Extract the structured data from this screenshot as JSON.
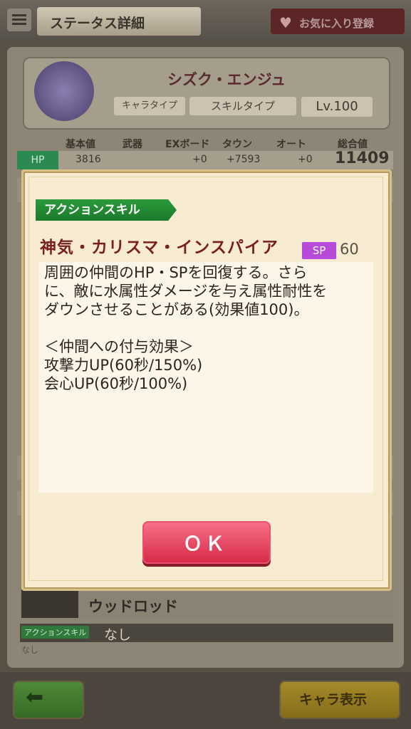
{
  "header": {
    "title": "ステータス詳細",
    "favorite_label": "お気に入り登録"
  },
  "character": {
    "name": "シズク・エンジュ",
    "chara_type_label": "キャラタイプ",
    "skill_type_label": "スキルタイプ",
    "level": "Lv.100"
  },
  "stats": {
    "columns": [
      "基本値",
      "武器",
      "EXボード",
      "タウン",
      "オート",
      "総合値"
    ],
    "hp": {
      "label": "HP",
      "base": "3816",
      "weapon": "",
      "ex_board": "+0",
      "town": "+7593",
      "auto": "+0",
      "total": "11409"
    }
  },
  "equipment": {
    "weapon_name": "ウッドロッド",
    "skill_badge": "アクションスキル",
    "skill_value": "なし",
    "skill_desc": "なし"
  },
  "footer": {
    "chara_button_label": "キャラ表示"
  },
  "modal": {
    "section_label": "アクションスキル",
    "skill_name": "神気・カリスマ・インスパイア",
    "sp_label": "SP",
    "sp_value": "60",
    "description": "周囲の仲間のHP・SPを回復する。さら\nに、敵に水属性ダメージを与え属性耐性を\nダウンさせることがある(効果値100)。\n\n＜仲間への付与効果＞\n攻撃力UP(60秒/150%)\n会心UP(60秒/100%)",
    "ok_label": "ＯＫ"
  },
  "colors": {
    "modal_bg": "#f7ecd2",
    "section_green": "#1a7a2a",
    "skill_name_red": "#7a1f1f",
    "sp_purple": "#b84ad8",
    "ok_red": "#d62a48"
  }
}
